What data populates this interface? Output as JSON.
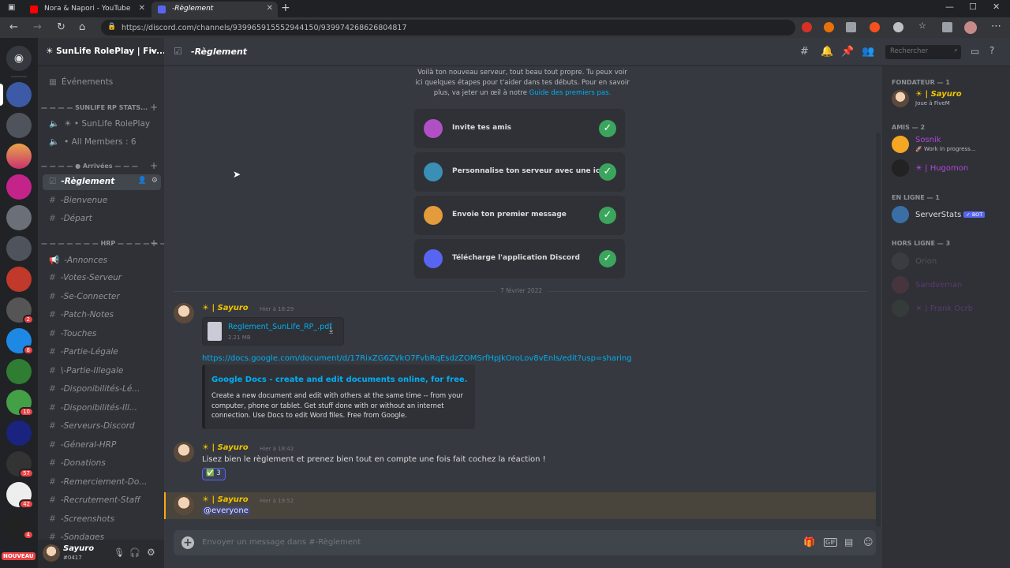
{
  "browser": {
    "tabs": [
      {
        "title": "Nora & Napori - YouTube",
        "color": "#ff0000"
      },
      {
        "title": "-Règlement",
        "color": "#5865f2"
      }
    ],
    "url": "https://discord.com/channels/939965915552944150/939974268626804817",
    "new_tab": "+",
    "controls": {
      "minimize": "—",
      "maximize": "☐",
      "close": "✕",
      "menu": "⋯"
    }
  },
  "server": {
    "name": "☀ SunLife RolePlay | Fiv...",
    "badges": [
      "2",
      "8",
      "10",
      "57",
      "42",
      "4"
    ],
    "new_label": "NOUVEAU"
  },
  "channels": {
    "events": "Événements",
    "cat_stats": "SUNLIFE RP STATS...",
    "voice1": "☀ • SunLife RolePlay",
    "voice2": "• All Members : 6",
    "cat_arrivees": "Arrivées",
    "list": [
      {
        "name": "-Règlement",
        "active": true
      },
      {
        "name": "-Bienvenue"
      },
      {
        "name": "-Départ"
      }
    ],
    "cat_hrp": "HRP",
    "hrp": [
      "-Annonces",
      "-Votes-Serveur",
      "-Se-Connecter",
      "-Patch-Notes",
      "-Touches",
      "-Partie-Légale",
      "\\-Partie-Illegale",
      "-Disponibilités-Lé...",
      "-Disponibilités-Ill...",
      "-Serveurs-Discord",
      "-Géneral-HRP",
      "-Donations",
      "-Remerciement-Do...",
      "-Recrutement-Staff",
      "-Screenshots",
      "-Sondages"
    ]
  },
  "user": {
    "name": "Sayuro",
    "tag": "#0417"
  },
  "topbar": {
    "title": "-Règlement",
    "search_placeholder": "Rechercher"
  },
  "welcome": {
    "text": "Voilà ton nouveau serveur, tout beau tout propre. Tu peux voir ici quelques étapes pour t'aider dans tes débuts. Pour en savoir plus, va jeter un œil à notre",
    "link": "Guide des premiers pas.",
    "tasks": [
      "Invite tes amis",
      "Personnalise ton serveur avec une icône",
      "Envoie ton premier message",
      "Télécharge l'application Discord"
    ]
  },
  "date_divider": "7 février 2022",
  "messages": [
    {
      "author": "☀ | Sayuro",
      "time": "Hier à 18:29",
      "file": {
        "name": "Reglement_SunLife_RP_.pdf",
        "size": "2.21 MB"
      },
      "link": "https://docs.google.com/document/d/17RixZG6ZVkO7FvbRqEsdzZOMSrfHpJkOroLov8vEnls/edit?usp=sharing",
      "embed": {
        "title": "Google Docs - create and edit documents online, for free.",
        "desc": "Create a new document and edit with others at the same time -- from your computer, phone or tablet. Get stuff done with or without an internet connection. Use Docs to edit Word files. Free from Google."
      }
    },
    {
      "author": "☀ | Sayuro",
      "time": "Hier à 18:42",
      "text": "Lisez bien le règlement et prenez bien tout en compte une fois fait cochez la réaction !",
      "reaction": "✅ 3"
    },
    {
      "author": "☀ | Sayuro",
      "time": "Hier à 19:52",
      "mention": "@everyone"
    }
  ],
  "composer": {
    "placeholder": "Envoyer un message dans #-Règlement"
  },
  "members": {
    "fondateur": "FONDATEUR — 1",
    "founder": {
      "name": "☀ | Sayuro",
      "status": "Joue à FiveM"
    },
    "amis": "AMIS — 2",
    "amis_list": [
      {
        "name": "Sosnik",
        "status": "🚀 Work in progress...",
        "color": "#b146dc"
      },
      {
        "name": "☀ | Hugomon",
        "status": "",
        "color": "#b146dc"
      }
    ],
    "enligne": "EN LIGNE — 1",
    "bot": {
      "name": "ServerStats",
      "badge": "✓ BOT"
    },
    "horsligne": "HORS LIGNE — 3",
    "offline": [
      {
        "name": "Orion"
      },
      {
        "name": "Sandveman"
      },
      {
        "name": "☀ | Frank Ocrb"
      }
    ]
  }
}
